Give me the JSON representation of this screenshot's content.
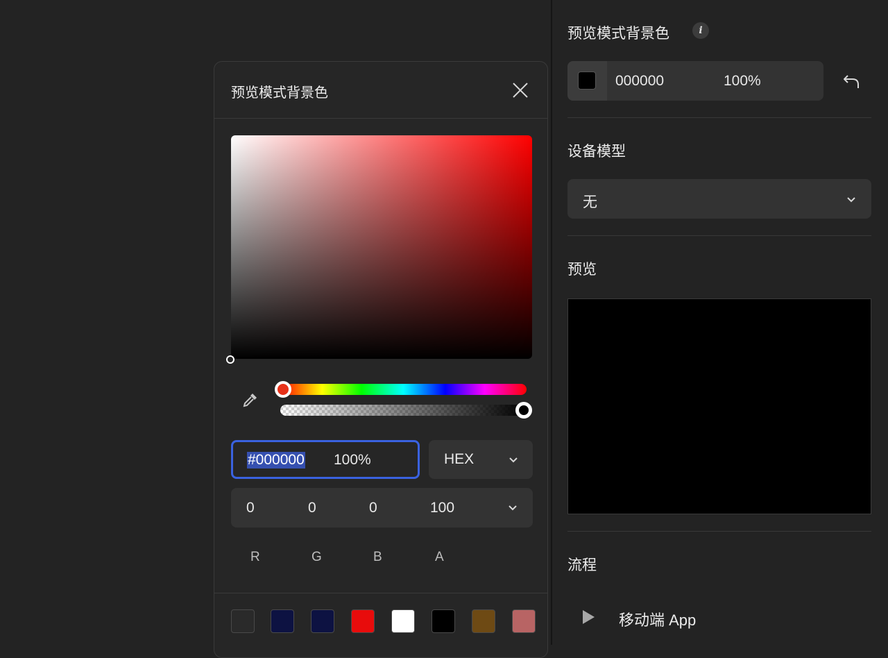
{
  "picker": {
    "title": "预览模式背景色",
    "hue_position": 0,
    "alpha_position": 1.0,
    "hex_value": "#000000",
    "alpha_value": "100%",
    "format": "HEX",
    "rgba": {
      "r": "0",
      "g": "0",
      "b": "0",
      "a": "100"
    },
    "labels": {
      "r": "R",
      "g": "G",
      "b": "B",
      "a": "A"
    },
    "swatches": [
      "#2a2a2a",
      "#0d1242",
      "#0d1242",
      "#e80c0c",
      "#ffffff",
      "#000000",
      "#6e4a14",
      "#b86464"
    ]
  },
  "right": {
    "bg_section": {
      "title": "预览模式背景色",
      "info_icon": "info-icon",
      "color_hex": "000000",
      "alpha": "100%",
      "undo_icon": "undo-icon"
    },
    "device_section": {
      "title": "设备模型",
      "value": "无"
    },
    "preview_section": {
      "title": "预览",
      "preview_color": "#000000"
    },
    "flow_section": {
      "title": "流程",
      "item_label": "移动端 App",
      "item_icon": "play-icon"
    }
  },
  "colors": {
    "accent": "#3a62e0",
    "panel_bg": "#262626",
    "field_bg": "#333333"
  }
}
